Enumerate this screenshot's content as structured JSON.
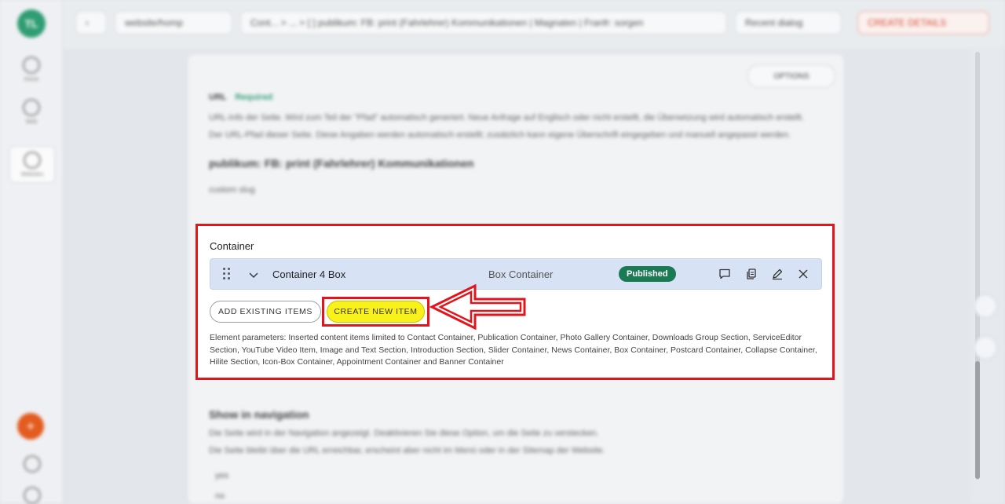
{
  "rail": {
    "logo_text": "TL",
    "items": [
      "Home",
      "Web",
      "Websites"
    ]
  },
  "topbar": {
    "site_select": "website/homp",
    "breadcrumb": "Cont... > ... > [ ] publikum: FB: print (Fahrlehrer) Kommunikationen | Magnaten | Franfr: sorgen",
    "view_select": "Recent dialog",
    "action_button": "CREATE DETAILS"
  },
  "page": {
    "options_label": "OPTIONS",
    "blurred_top": {
      "heading": "URL",
      "status": "Required",
      "line1": "URL-Info der Seite. Wird zum Teil der \"Pfad\" automatisch generiert. Neue Anfrage auf Englisch oder nicht erstellt, die Übersetzung wird automatisch erstellt.",
      "line2": "Der URL-Pfad dieser Seite. Diese Angaben werden automatisch erstellt; zusätzlich kann eigene Überschrift eingegeben und manuell angepasst werden.",
      "title_line": "publikum: FB: print (Fahrlehrer) Kommunikationen",
      "small_line": "custom slug"
    },
    "blurred_bottom": {
      "heading": "Show in navigation",
      "line1": "Die Seite wird in der Navigation angezeigt. Deaktivieren Sie diese Option, um die Seite zu verstecken.",
      "line2": "Die Seite bleibt über die URL erreichbar, erscheint aber nicht im Menü oder in der Sitemap der Website.",
      "opt1": "yes",
      "opt2": "no"
    }
  },
  "container": {
    "title": "Container",
    "item": {
      "name": "Container 4 Box",
      "type": "Box Container",
      "status": "Published"
    },
    "buttons": {
      "add_existing": "ADD EXISTING ITEMS",
      "create_new": "CREATE NEW ITEM"
    },
    "params_text": "Element parameters: Inserted content items limited to Contact Container, Publication Container, Photo Gallery Container, Downloads Group Section, ServiceEditor Section, YouTube Video Item, Image and Text Section, Introduction Section, Slider Container, News Container, Box Container, Postcard Container, Collapse Container, Hilite Section, Icon-Box Container, Appointment Container and Banner Container"
  },
  "colors": {
    "highlight_red": "#e3141c",
    "published_green": "#197a53",
    "create_yellow": "#f9f21a",
    "row_blue": "#d7e3f4"
  }
}
